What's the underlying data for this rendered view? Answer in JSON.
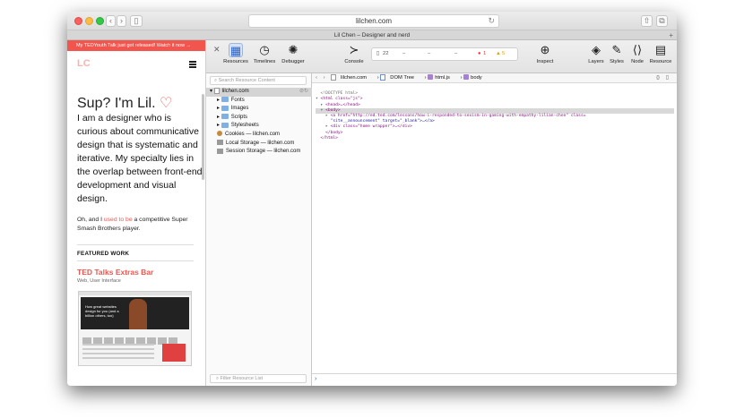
{
  "browser": {
    "url": "lilchen.com",
    "tab_title": "Lil Chen – Designer and nerd",
    "back_icon": "chevron-left-icon",
    "forward_icon": "chevron-right-icon",
    "new_tab": "+"
  },
  "page": {
    "banner": "My TEDYouth Talk just got released! Watch it now  →",
    "logo": "LC",
    "greeting": "Sup? I'm Lil.",
    "greeting_icon": "♡",
    "intro": "I am a designer who is curious about communicative design that is systematic and iterative. My specialty lies in the overlap between front-end development and visual design.",
    "small_pre": "Oh, and I ",
    "small_link": "used to be",
    "small_post": " a competitive Super Smash Brothers player.",
    "featured_heading": "FEATURED WORK",
    "work_title": "TED Talks Extras Bar",
    "work_sub": "Web, User Interface",
    "thumb_text": "How great websites design for you (and a billion others, too)"
  },
  "inspector": {
    "tools_left": [
      {
        "label": "Resources",
        "icon": "▦"
      },
      {
        "label": "Timelines",
        "icon": "◷"
      },
      {
        "label": "Debugger",
        "icon": "✺"
      }
    ],
    "console_label": "Console",
    "console_icon": "≻",
    "status": {
      "pages": "22",
      "bar1": "–",
      "bar2": "–",
      "time": "–",
      "errors": "1",
      "warnings": "5"
    },
    "inspect_label": "Inspect",
    "tools_right": [
      {
        "label": "Layers",
        "icon": "◈"
      },
      {
        "label": "Styles",
        "icon": "✎"
      },
      {
        "label": "Node",
        "icon": "⟨⟩"
      },
      {
        "label": "Resource",
        "icon": "▤"
      }
    ],
    "search_placeholder": "Search Resource Content",
    "filter_placeholder": "Filter Resource List",
    "tree": {
      "root": "lilchen.com",
      "folders": [
        "Fonts",
        "Images",
        "Scripts",
        "Stylesheets"
      ],
      "cookies": "Cookies — lilchen.com",
      "local": "Local Storage — lilchen.com",
      "session": "Session Storage — lilchen.com"
    },
    "breadcrumbs": [
      "lilchen.com",
      "DOM Tree",
      "html.js",
      "body"
    ],
    "code": {
      "doctype": "<!DOCTYPE html>",
      "html_open": "<html class=\"js\">",
      "head": "<head>…</head>",
      "body_open": "<body>",
      "a_line": "<a href=\"http://ed.ted.com/lessons/how-i-responded-to-sexism-in-gaming-with-empathy-lilian-chen\" class=",
      "a_line2": "\"site__announcement\" target=\"_blank\">…</a>",
      "div_line": "<div class=\"home wrapper\">…</div>",
      "body_close": "</body>",
      "html_close": "</html>"
    },
    "console_prompt": "›"
  },
  "colors": {
    "accent": "#f2544e",
    "selection": "#d6e2f3"
  }
}
